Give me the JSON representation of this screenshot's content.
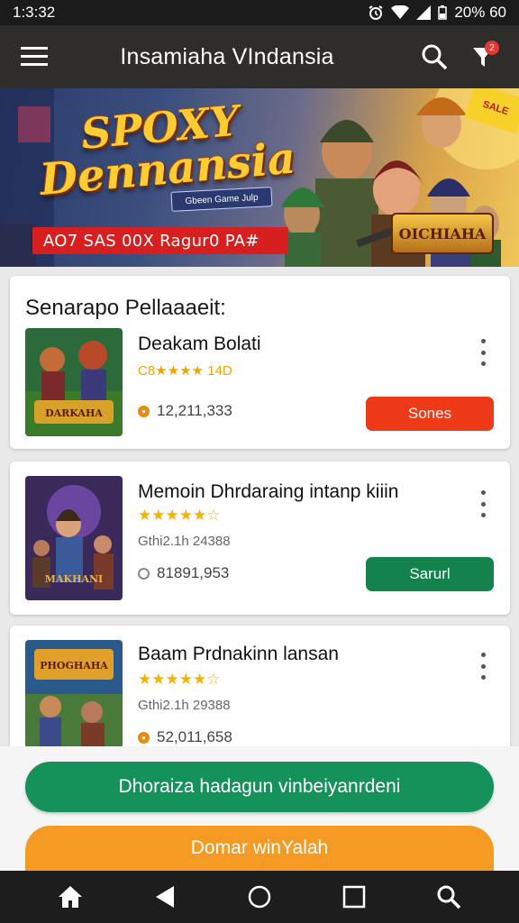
{
  "status_bar": {
    "time": "1:3:32",
    "right_text": "20% 60"
  },
  "app_bar": {
    "title": "Insamiaha VIndansia",
    "notification_count": "2"
  },
  "banner": {
    "title_line1": "SPOXY",
    "title_line2": "Dennansia",
    "chip_text": "Gbeen Game Julp",
    "promo_text": "AO7 SAS 00X Ragur0 PA#",
    "badge_text": "OICHIAHA",
    "corner_text": "SALE"
  },
  "section": {
    "title": "Senarapo Pellaaaeit:"
  },
  "games": [
    {
      "name": "Deakam Bolati",
      "rating_text": "C8★★★★ 14D",
      "downloads": "12,211,333",
      "action_label": "Sones",
      "thumb_text": "DARKAHA"
    },
    {
      "name": "Memoin Dhrdaraing intanp kiiin",
      "stars": "★★★★★☆",
      "meta": "Gthi2.1h   24388",
      "downloads": "81891,953",
      "action_label": "Sarurl",
      "thumb_text": "MAKHANI"
    },
    {
      "name": "Baam Prdnakinn lansan",
      "stars": "★★★★★☆",
      "meta": "Gthi2.1h   29388",
      "downloads": "52,011,658",
      "thumb_text": "PHOGHAHA"
    }
  ],
  "bottom": {
    "primary_cta": "Dhoraiza hadagun vinbeiyanrdeni",
    "secondary_cta": "Domar winYalah"
  },
  "colors": {
    "accent_red": "#ee3a18",
    "accent_green": "#13824c",
    "accent_orange": "#f59a23"
  }
}
